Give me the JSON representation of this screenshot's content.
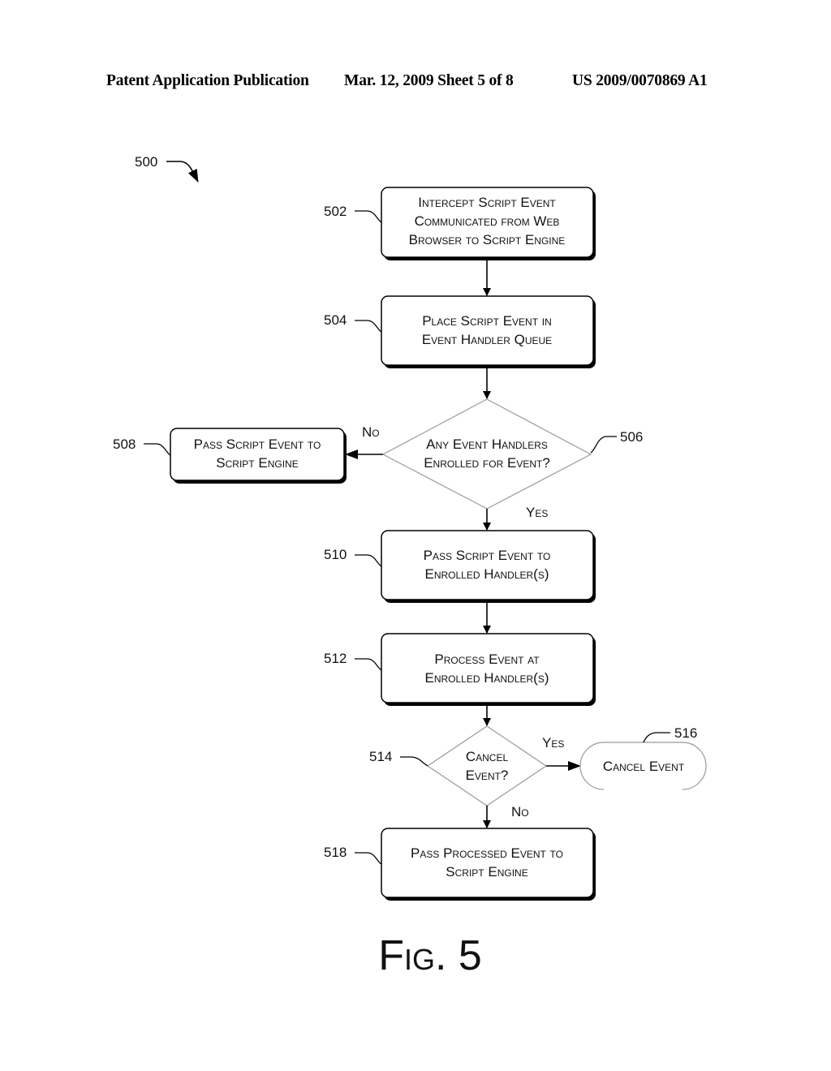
{
  "header": {
    "publication": "Patent Application Publication",
    "date_sheet": "Mar. 12, 2009  Sheet 5 of 8",
    "number": "US 2009/0070869 A1"
  },
  "figure": {
    "label": "Fig. 5",
    "ref": "500"
  },
  "steps": {
    "s502": {
      "ref": "502",
      "lines": [
        "Intercept Script Event",
        "Communicated from Web",
        "Browser to Script Engine"
      ]
    },
    "s504": {
      "ref": "504",
      "lines": [
        "Place Script Event in",
        "Event Handler Queue"
      ]
    },
    "s506": {
      "ref": "506",
      "lines": [
        "Any Event Handlers",
        "Enrolled for Event?"
      ]
    },
    "s508": {
      "ref": "508",
      "lines": [
        "Pass Script Event to",
        "Script Engine"
      ]
    },
    "s510": {
      "ref": "510",
      "lines": [
        "Pass Script Event to",
        "Enrolled Handler(s)"
      ]
    },
    "s512": {
      "ref": "512",
      "lines": [
        "Process Event at",
        "Enrolled Handler(s)"
      ]
    },
    "s514": {
      "ref": "514",
      "lines": [
        "Cancel",
        "Event?"
      ]
    },
    "s516": {
      "ref": "516",
      "lines": [
        "Cancel Event"
      ]
    },
    "s518": {
      "ref": "518",
      "lines": [
        "Pass Processed Event to",
        "Script Engine"
      ]
    }
  },
  "branches": {
    "d506_no": "No",
    "d506_yes": "Yes",
    "d514_yes": "Yes",
    "d514_no": "No"
  }
}
